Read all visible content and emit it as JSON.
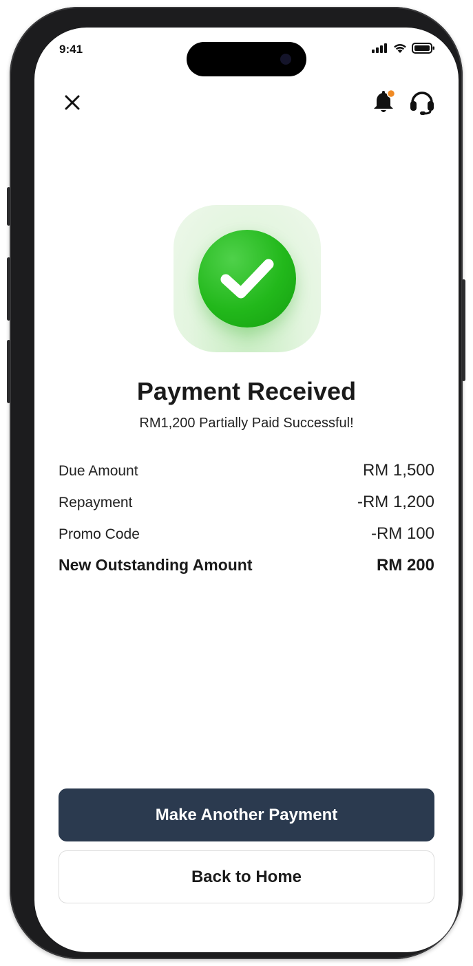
{
  "status_bar": {
    "time": "9:41",
    "icons": [
      "signal-icon",
      "wifi-icon",
      "battery-icon"
    ]
  },
  "header": {
    "close_icon": "close-icon",
    "notification_icon": "bell-icon",
    "support_icon": "headset-icon"
  },
  "result": {
    "icon": "success-check-icon",
    "title": "Payment Received",
    "subtitle": "RM1,200 Partially Paid Successful!"
  },
  "summary": [
    {
      "label": "Due Amount",
      "value": "RM 1,500",
      "emphasis": false
    },
    {
      "label": "Repayment",
      "value": "-RM 1,200",
      "emphasis": false
    },
    {
      "label": "Promo Code",
      "value": "-RM 100",
      "emphasis": false
    },
    {
      "label": "New Outstanding Amount",
      "value": "RM 200",
      "emphasis": true
    }
  ],
  "actions": {
    "primary_label": "Make Another Payment",
    "secondary_label": "Back to Home"
  },
  "colors": {
    "primary_button": "#2b3a4f",
    "success_green": "#22b81b",
    "notification_dot": "#f08a24"
  }
}
